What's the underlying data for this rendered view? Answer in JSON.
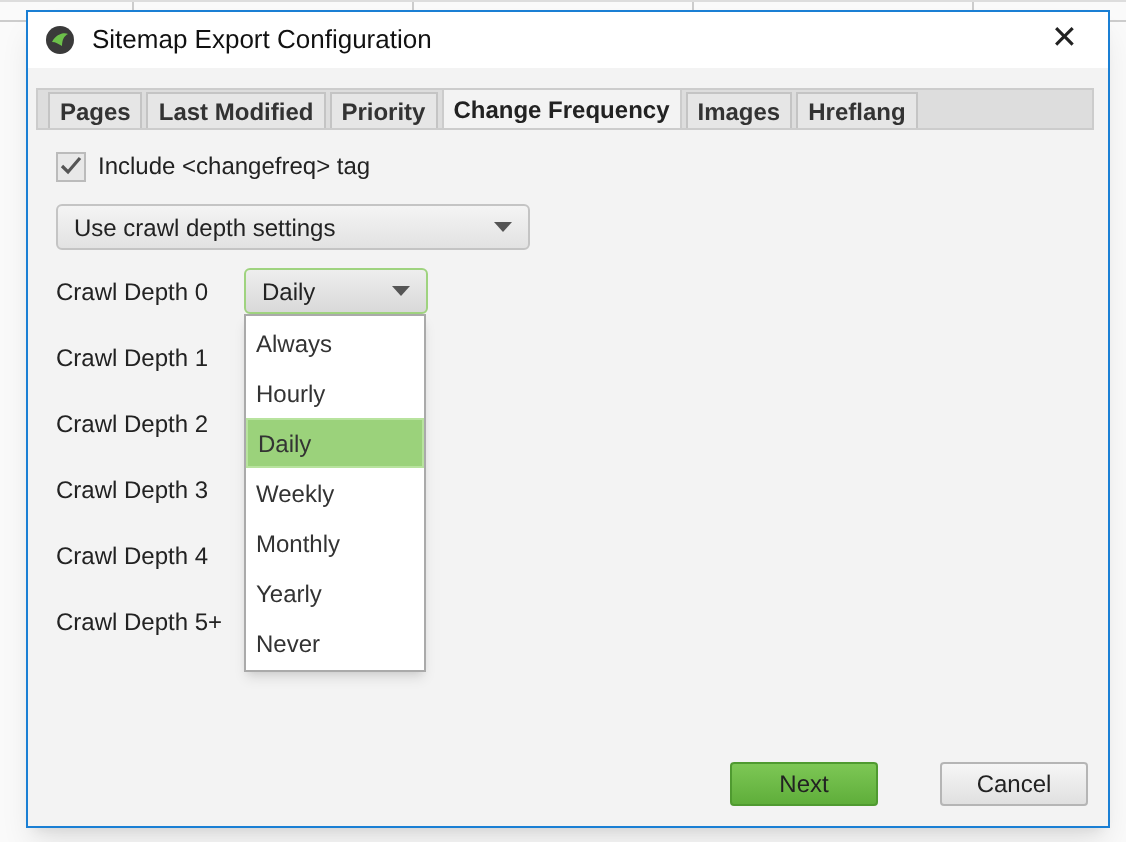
{
  "window": {
    "title": "Sitemap Export Configuration",
    "close": "✕"
  },
  "tabs": [
    {
      "label": "Pages",
      "selected": false
    },
    {
      "label": "Last Modified",
      "selected": false
    },
    {
      "label": "Priority",
      "selected": false
    },
    {
      "label": "Change Frequency",
      "selected": true
    },
    {
      "label": "Images",
      "selected": false
    },
    {
      "label": "Hreflang",
      "selected": false
    }
  ],
  "include_tag": {
    "label": "Include <changefreq> tag",
    "checked": true
  },
  "mode_select": {
    "value": "Use crawl depth settings"
  },
  "depths": [
    {
      "label": "Crawl Depth 0",
      "value": "Daily",
      "open": true
    },
    {
      "label": "Crawl Depth 1"
    },
    {
      "label": "Crawl Depth 2"
    },
    {
      "label": "Crawl Depth 3"
    },
    {
      "label": "Crawl Depth 4"
    },
    {
      "label": "Crawl Depth 5+"
    }
  ],
  "dropdown_options": [
    {
      "label": "Always",
      "selected": false
    },
    {
      "label": "Hourly",
      "selected": false
    },
    {
      "label": "Daily",
      "selected": true
    },
    {
      "label": "Weekly",
      "selected": false
    },
    {
      "label": "Monthly",
      "selected": false
    },
    {
      "label": "Yearly",
      "selected": false
    },
    {
      "label": "Never",
      "selected": false
    }
  ],
  "buttons": [
    {
      "label": "Next",
      "kind": "primary"
    },
    {
      "label": "Cancel",
      "kind": "secondary"
    }
  ]
}
